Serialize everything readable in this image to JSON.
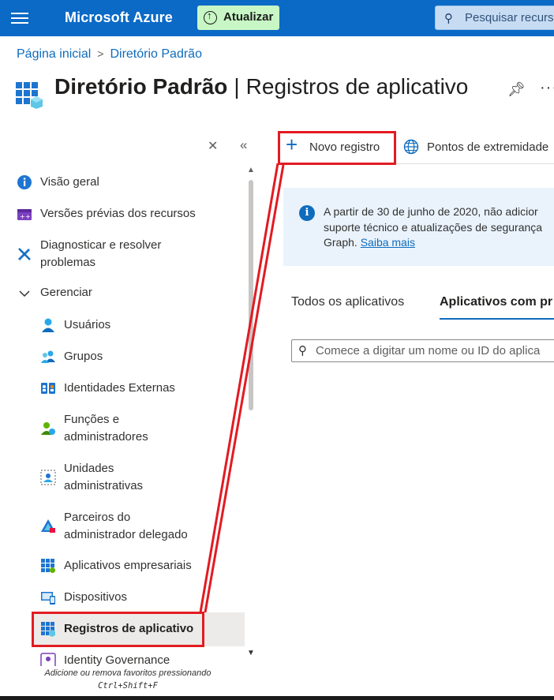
{
  "topbar": {
    "brand": "Microsoft Azure",
    "update_label": "Atualizar",
    "search_placeholder": "Pesquisar recurs"
  },
  "breadcrumb": [
    "Página inicial",
    "Diretório Padrão"
  ],
  "page": {
    "title_bold": "Diretório Padrão",
    "title_separator": "|",
    "title_rest": "Registros de aplicativo",
    "more_label": "···"
  },
  "nav": {
    "items": [
      {
        "label": "Visão geral",
        "icon": "info-icon"
      },
      {
        "label": "Versões prévias dos recursos",
        "icon": "preview-features-icon"
      },
      {
        "label": "Diagnosticar e resolver",
        "label2": "problemas",
        "icon": "wrench-screwdriver-icon"
      },
      {
        "label": "Gerenciar",
        "icon": "chevron-down-icon"
      },
      {
        "label": "Usuários",
        "icon": "user-icon"
      },
      {
        "label": "Grupos",
        "icon": "group-icon"
      },
      {
        "label": "Identidades Externas",
        "icon": "external-identities-icon"
      },
      {
        "label": "Funções e",
        "label2": "administradores",
        "icon": "roles-icon"
      },
      {
        "label": "Unidades",
        "label2": "administrativas",
        "icon": "admin-units-icon"
      },
      {
        "label": "Parceiros do",
        "label2": "administrador delegado",
        "icon": "partner-icon"
      },
      {
        "label": "Aplicativos empresariais",
        "icon": "enterprise-apps-icon"
      },
      {
        "label": "Dispositivos",
        "icon": "devices-icon"
      },
      {
        "label": "Registros de aplicativo",
        "icon": "app-registrations-icon"
      },
      {
        "label": "Identity Governance",
        "icon": "identity-governance-icon"
      }
    ],
    "favorites_hint": "Adicione ou remova favoritos pressionando",
    "favorites_shortcut": "Ctrl+Shift+F"
  },
  "commands": {
    "new_registration": "Novo registro",
    "endpoints": "Pontos de extremidade"
  },
  "infobox": {
    "line1": "A partir de 30 de junho de 2020, não adicior",
    "line2": "suporte técnico e atualizações de segurança",
    "line3_prefix": "Graph.",
    "link": "Saiba mais"
  },
  "tabs": [
    "Todos os aplicativos",
    "Aplicativos com pr"
  ],
  "filter": {
    "placeholder": "Comece a digitar um nome ou ID do aplica"
  },
  "colors": {
    "topbar": "#0b6ac6",
    "accent": "#0f6cbd",
    "annotation_red": "#e21b22",
    "update_button": "#c8f7c5"
  }
}
